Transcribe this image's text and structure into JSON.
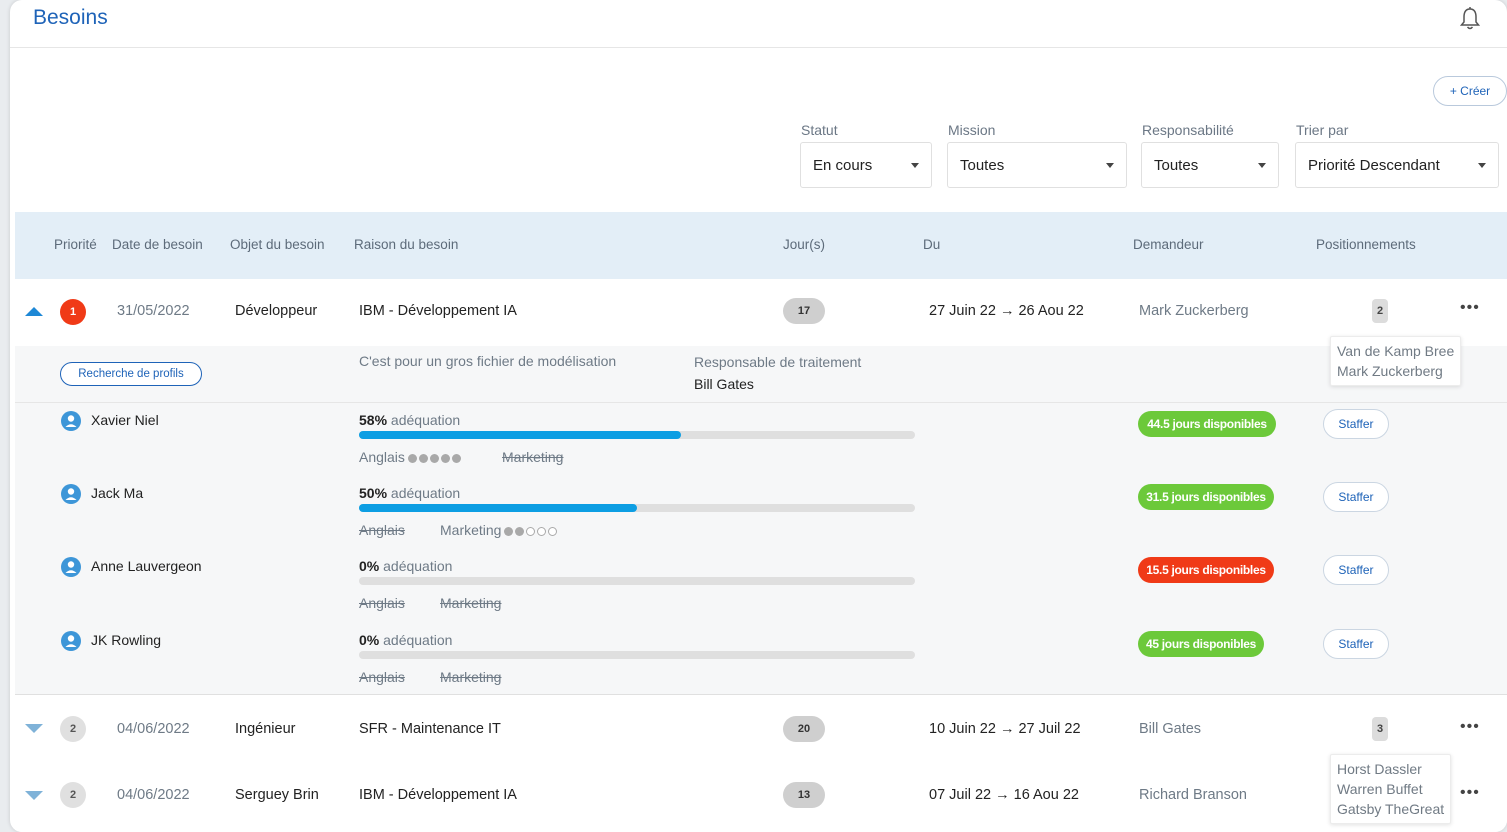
{
  "header": {
    "title": "Besoins"
  },
  "actions": {
    "create_label": "+ Créer"
  },
  "filters": [
    {
      "label": "Statut",
      "value": "En cours"
    },
    {
      "label": "Mission",
      "value": "Toutes"
    },
    {
      "label": "Responsabilité",
      "value": "Toutes"
    },
    {
      "label": "Trier par",
      "value": "Priorité Descendant"
    }
  ],
  "columns": {
    "priority": "Priorité",
    "date": "Date de besoin",
    "object": "Objet du besoin",
    "reason": "Raison du besoin",
    "days": "Jour(s)",
    "period": "Du",
    "requester": "Demandeur",
    "positions": "Positionnements"
  },
  "rows": [
    {
      "priority": "1",
      "date": "31/05/2022",
      "object": "Développeur",
      "reason": "IBM - Développement IA",
      "days": "17",
      "period": "27 Juin 22 → 26 Aou 22",
      "requester": "Mark Zuckerberg",
      "positions": "2",
      "positions_names": [
        "Van de Kamp Bree",
        "Mark Zuckerberg"
      ]
    },
    {
      "priority": "2",
      "date": "04/06/2022",
      "object": "Ingénieur",
      "reason": "SFR - Maintenance IT",
      "days": "20",
      "period": "10 Juin 22 → 27 Juil 22",
      "requester": "Bill Gates",
      "positions": "3"
    },
    {
      "priority": "2",
      "date": "04/06/2022",
      "object": "Serguey Brin",
      "reason": "IBM - Développement IA",
      "days": "13",
      "period": "07 Juil 22 → 16 Aou 22",
      "requester": "Richard Branson",
      "positions_names": [
        "Horst Dassler",
        "Warren Buffet",
        "Gatsby TheGreat"
      ]
    }
  ],
  "detail": {
    "search_profiles_label": "Recherche de profils",
    "description": "C'est pour un gros fichier de modélisation",
    "processing_label": "Responsable de traitement",
    "processing_value": "Bill Gates",
    "adequation_word": "adéquation",
    "staff_label": "Staffer",
    "candidates": [
      {
        "name": "Xavier Niel",
        "percent": "58%",
        "fill": 0.58,
        "skill1": "Anglais",
        "skill1_level": 5,
        "skill1_struck": false,
        "skill2": "Marketing",
        "skill2_struck": true,
        "availability": "44.5 jours disponibles",
        "avail_color": "#6cc93a"
      },
      {
        "name": "Jack Ma",
        "percent": "50%",
        "fill": 0.5,
        "skill1": "Anglais",
        "skill1_struck": true,
        "skill2": "Marketing",
        "skill2_level": 2,
        "skill2_struck": false,
        "availability": "31.5 jours disponibles",
        "avail_color": "#6cc93a"
      },
      {
        "name": "Anne Lauvergeon",
        "percent": "0%",
        "fill": 0,
        "skill1": "Anglais",
        "skill1_struck": true,
        "skill2": "Marketing",
        "skill2_struck": true,
        "availability": "15.5 jours disponibles",
        "avail_color": "#f03a17"
      },
      {
        "name": "JK Rowling",
        "percent": "0%",
        "fill": 0,
        "skill1": "Anglais",
        "skill1_struck": true,
        "skill2": "Marketing",
        "skill2_struck": true,
        "availability": "45 jours disponibles",
        "avail_color": "#6cc93a"
      }
    ]
  },
  "icons": {
    "notifications": "bell-icon",
    "avatar": "user-avatar-icon",
    "more": "more-dots-icon",
    "expand": "triangle-icon",
    "dropdown": "caret-down-icon"
  }
}
